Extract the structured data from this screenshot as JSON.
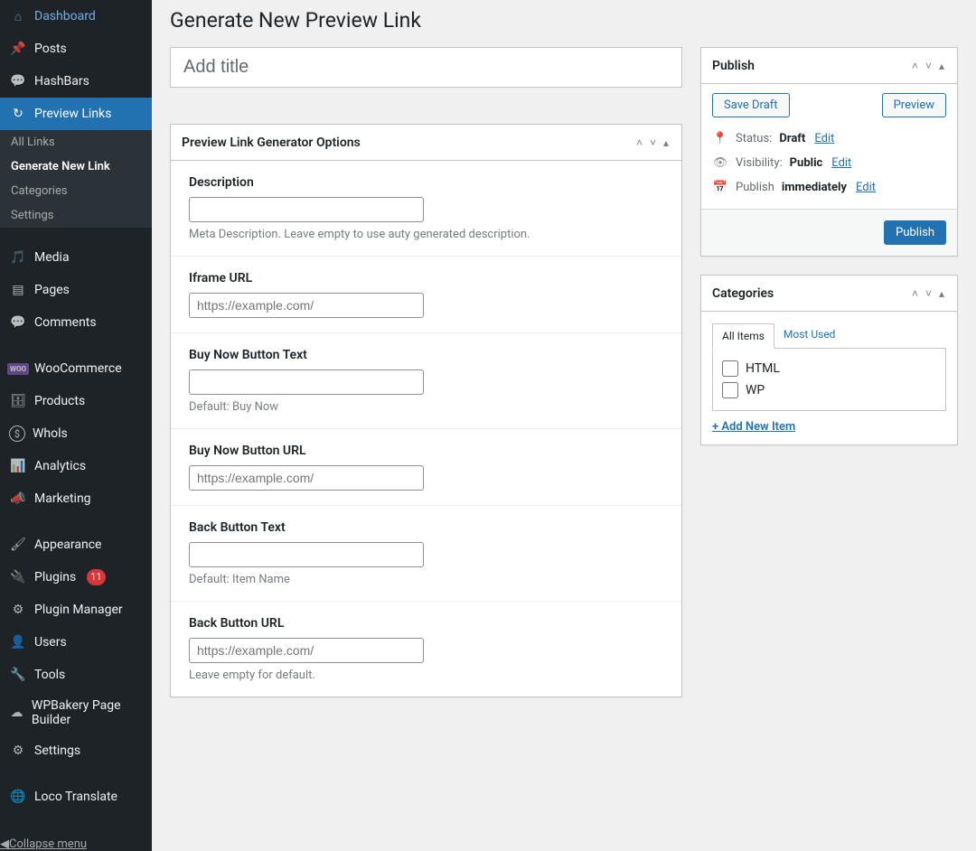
{
  "sidebar": {
    "items": [
      {
        "id": "dashboard",
        "label": "Dashboard",
        "icon": "dashboard"
      },
      {
        "id": "posts",
        "label": "Posts",
        "icon": "pin"
      },
      {
        "id": "hashbars",
        "label": "HashBars",
        "icon": "chat"
      },
      {
        "id": "previewlinks",
        "label": "Preview Links",
        "icon": "redo",
        "current": true,
        "sub": [
          {
            "id": "alllinks",
            "label": "All Links"
          },
          {
            "id": "gennew",
            "label": "Generate New Link",
            "current": true
          },
          {
            "id": "cats",
            "label": "Categories"
          },
          {
            "id": "settings",
            "label": "Settings"
          }
        ]
      },
      {
        "id": "media",
        "label": "Media",
        "icon": "media",
        "sep": true
      },
      {
        "id": "pages",
        "label": "Pages",
        "icon": "page"
      },
      {
        "id": "comments",
        "label": "Comments",
        "icon": "comment"
      },
      {
        "id": "woo",
        "label": "WooCommerce",
        "icon": "woo",
        "sep": true
      },
      {
        "id": "products",
        "label": "Products",
        "icon": "archive"
      },
      {
        "id": "whols",
        "label": "Whols",
        "icon": "dollar"
      },
      {
        "id": "analytics",
        "label": "Analytics",
        "icon": "bars"
      },
      {
        "id": "marketing",
        "label": "Marketing",
        "icon": "megaphone"
      },
      {
        "id": "appearance",
        "label": "Appearance",
        "icon": "brush",
        "sep": true
      },
      {
        "id": "plugins",
        "label": "Plugins",
        "icon": "plug",
        "badge": "11"
      },
      {
        "id": "pluginmgr",
        "label": "Plugin Manager",
        "icon": "gears"
      },
      {
        "id": "users",
        "label": "Users",
        "icon": "user"
      },
      {
        "id": "tools",
        "label": "Tools",
        "icon": "wrench"
      },
      {
        "id": "wpbakery",
        "label": "WPBakery Page Builder",
        "icon": "cloud"
      },
      {
        "id": "settings2",
        "label": "Settings",
        "icon": "sliders"
      },
      {
        "id": "loco",
        "label": "Loco Translate",
        "icon": "translate",
        "sep": true
      }
    ],
    "collapse": "Collapse menu"
  },
  "page": {
    "title": "Generate New Preview Link",
    "title_placeholder": "Add title"
  },
  "metabox": {
    "title": "Preview Link Generator Options",
    "fields": [
      {
        "label": "Description",
        "hint": "Meta Description. Leave empty to use auty generated description.",
        "ph": ""
      },
      {
        "label": "Iframe URL",
        "hint": "",
        "ph": "https://example.com/"
      },
      {
        "label": "Buy Now Button Text",
        "hint": "Default: Buy Now",
        "ph": ""
      },
      {
        "label": "Buy Now Button URL",
        "hint": "",
        "ph": "https://example.com/"
      },
      {
        "label": "Back Button Text",
        "hint": "Default: Item Name",
        "ph": ""
      },
      {
        "label": "Back Button URL",
        "hint": "Leave empty for default.",
        "ph": "https://example.com/"
      }
    ]
  },
  "publish": {
    "title": "Publish",
    "save_draft": "Save Draft",
    "preview": "Preview",
    "status_label": "Status:",
    "status_value": "Draft",
    "visibility_label": "Visibility:",
    "visibility_value": "Public",
    "schedule_label": "Publish",
    "schedule_value": "immediately",
    "edit": "Edit",
    "submit": "Publish"
  },
  "categories": {
    "title": "Categories",
    "tab_all": "All Items",
    "tab_used": "Most Used",
    "items": [
      "HTML",
      "WP"
    ],
    "add_new": "+ Add New Item"
  }
}
